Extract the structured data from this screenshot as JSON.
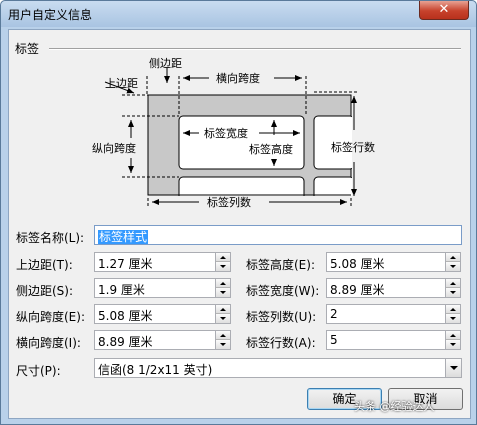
{
  "window": {
    "title": "用户自定义信息",
    "close_glyph": "✕"
  },
  "group": {
    "label": "标签"
  },
  "diagram": {
    "side_margin": "侧边距",
    "top_margin": "上边距",
    "horizontal_pitch": "横向跨度",
    "vertical_pitch": "纵向跨度",
    "label_width": "标签宽度",
    "label_height": "标签高度",
    "label_rows": "标签行数",
    "label_columns": "标签列数"
  },
  "form": {
    "label_name": {
      "label": "标签名称(L):",
      "value": "标签样式"
    },
    "top_margin": {
      "label": "上边距(T):",
      "value": "1.27 厘米"
    },
    "side_margin": {
      "label": "侧边距(S):",
      "value": "1.9 厘米"
    },
    "vertical_pitch": {
      "label": "纵向跨度(E):",
      "value": "5.08 厘米"
    },
    "horizontal_pitch": {
      "label": "横向跨度(I):",
      "value": "8.89 厘米"
    },
    "label_height": {
      "label": "标签高度(E):",
      "value": "5.08 厘米"
    },
    "label_width": {
      "label": "标签宽度(W):",
      "value": "8.89 厘米"
    },
    "label_columns": {
      "label": "标签列数(U):",
      "value": "2"
    },
    "label_rows": {
      "label": "标签行数(A):",
      "value": "5"
    },
    "size": {
      "label": "尺寸(P):",
      "value": "信函(8 1/2x11 英寸)"
    }
  },
  "buttons": {
    "ok": "确定",
    "cancel": "取消"
  },
  "watermark": "头条 @经验达人"
}
